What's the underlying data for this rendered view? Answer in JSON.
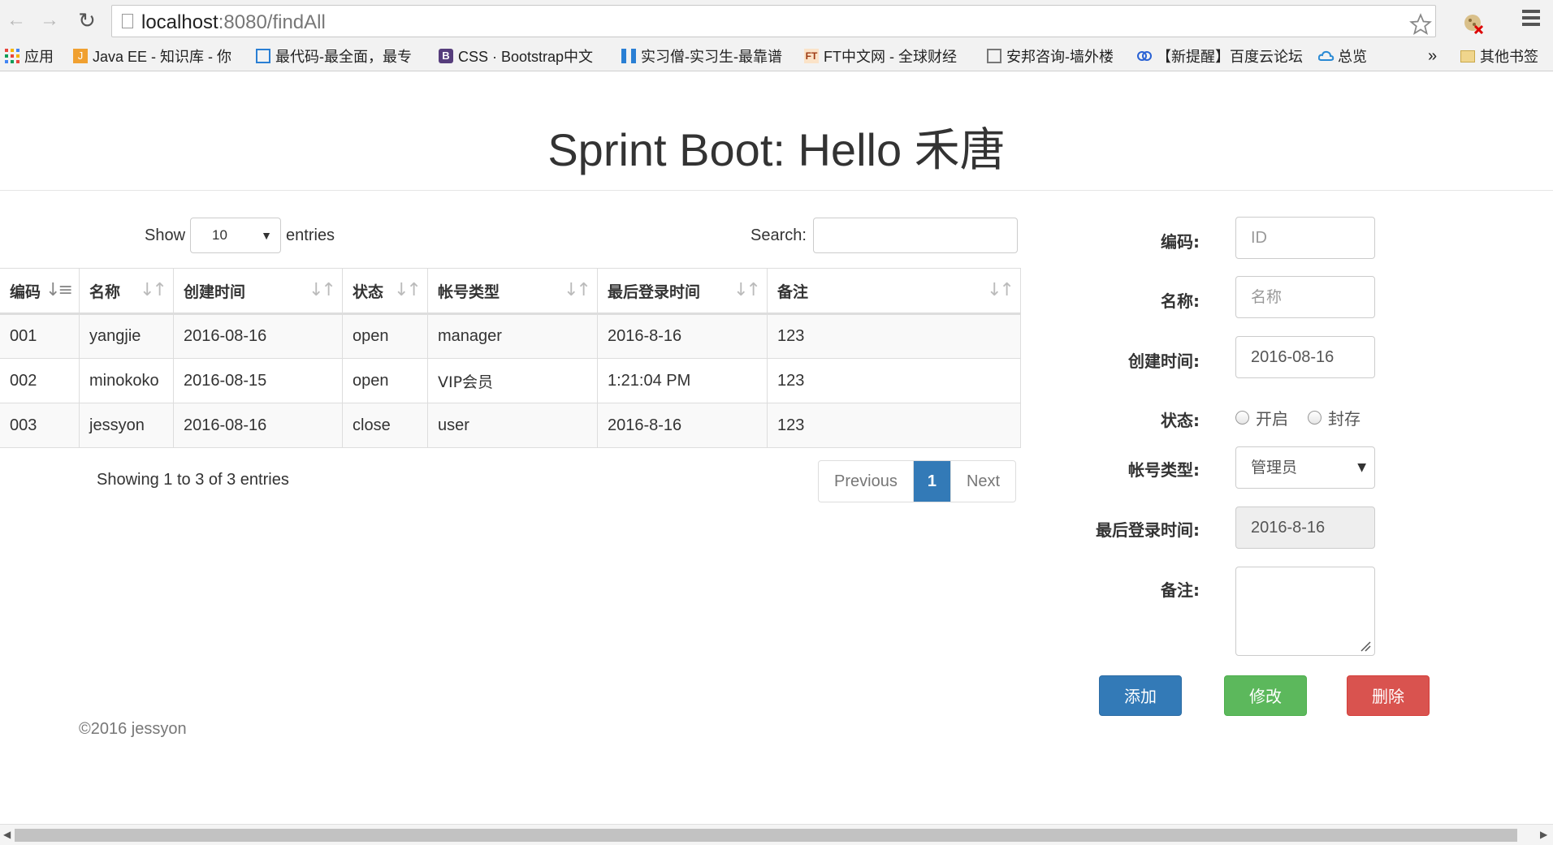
{
  "browser": {
    "url_host": "localhost",
    "url_port_path": ":8080/findAll",
    "bookmarks": [
      {
        "icon": "apps-icon",
        "label": "应用"
      },
      {
        "icon": "javaee-icon",
        "label": "Java EE - 知识库 - 你"
      },
      {
        "icon": "zuidaima-icon",
        "label": "最代码-最全面，最专"
      },
      {
        "icon": "bootstrap-icon",
        "label": "CSS · Bootstrap中文"
      },
      {
        "icon": "shixiseng-icon",
        "label": "实习僧-实习生-最靠谱"
      },
      {
        "icon": "ft-icon",
        "label": "FT中文网 - 全球财经"
      },
      {
        "icon": "anbang-icon",
        "label": "安邦咨询-墙外楼"
      },
      {
        "icon": "baidu-icon",
        "label": "【新提醒】百度云论坛"
      },
      {
        "icon": "cloud-icon",
        "label": "总览"
      }
    ],
    "overflow": "»",
    "other_bookmarks": "其他书签"
  },
  "page": {
    "title": "Sprint Boot: Hello 禾唐"
  },
  "table_controls": {
    "show_label": "Show",
    "page_size": "10",
    "entries_label": "entries",
    "search_label": "Search:"
  },
  "table": {
    "columns": [
      "编码",
      "名称",
      "创建时间",
      "状态",
      "帐号类型",
      "最后登录时间",
      "备注"
    ],
    "rows": [
      [
        "001",
        "yangjie",
        "2016-08-16",
        "open",
        "manager",
        "2016-8-16",
        "123"
      ],
      [
        "002",
        "minokoko",
        "2016-08-15",
        "open",
        "VIP会员",
        "1:21:04 PM",
        "123"
      ],
      [
        "003",
        "jessyon",
        "2016-08-16",
        "close",
        "user",
        "2016-8-16",
        "123"
      ]
    ]
  },
  "table_footer": {
    "info": "Showing 1 to 3 of 3 entries",
    "previous": "Previous",
    "current_page": "1",
    "next": "Next"
  },
  "form": {
    "id_label": "编码:",
    "id_placeholder": "ID",
    "name_label": "名称:",
    "name_placeholder": "名称",
    "created_label": "创建时间:",
    "created_value": "2016-08-16",
    "status_label": "状态:",
    "status_options": [
      "开启",
      "封存"
    ],
    "account_type_label": "帐号类型:",
    "account_type_value": "管理员",
    "last_login_label": "最后登录时间:",
    "last_login_value": "2016-8-16",
    "remark_label": "备注:",
    "remark_value": ""
  },
  "buttons": {
    "add": "添加",
    "edit": "修改",
    "delete": "删除"
  },
  "footer": {
    "copyright": "©2016 jessyon"
  },
  "colors": {
    "primary": "#337ab7",
    "success": "#5cb85c",
    "danger": "#d9534f"
  }
}
